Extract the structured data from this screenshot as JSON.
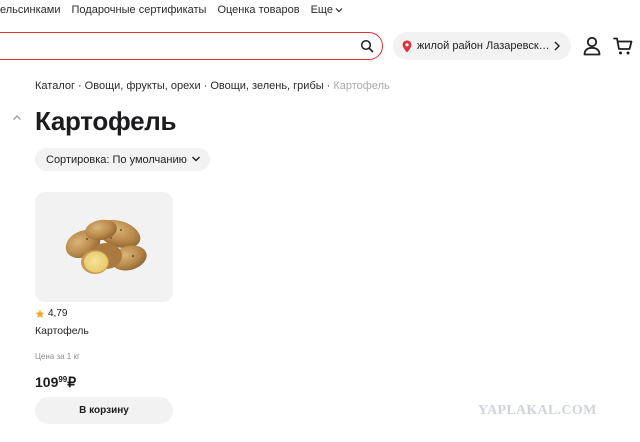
{
  "topnav": {
    "items": [
      "ельсинками",
      "Подарочные сертификаты",
      "Оценка товаров",
      "Еще"
    ]
  },
  "header": {
    "search": {
      "placeholder": "",
      "icon": "search-icon"
    },
    "location": {
      "text": "жилой район Лазаревск…"
    },
    "accent": "#e0313b"
  },
  "breadcrumb": [
    "Каталог",
    "Овощи, фрукты, орехи",
    "Овощи, зелень, грибы",
    "Картофель"
  ],
  "page": {
    "title": "Картофель"
  },
  "sort": {
    "label": "Сортировка: По умолчанию"
  },
  "product": {
    "rating": "4,79",
    "name": "Картофель",
    "unit": "Цена за 1 кг",
    "price_int": "109",
    "price_dec": "99",
    "currency": "₽",
    "button": "В корзину"
  },
  "watermark": "YAPLAKAL.COM"
}
